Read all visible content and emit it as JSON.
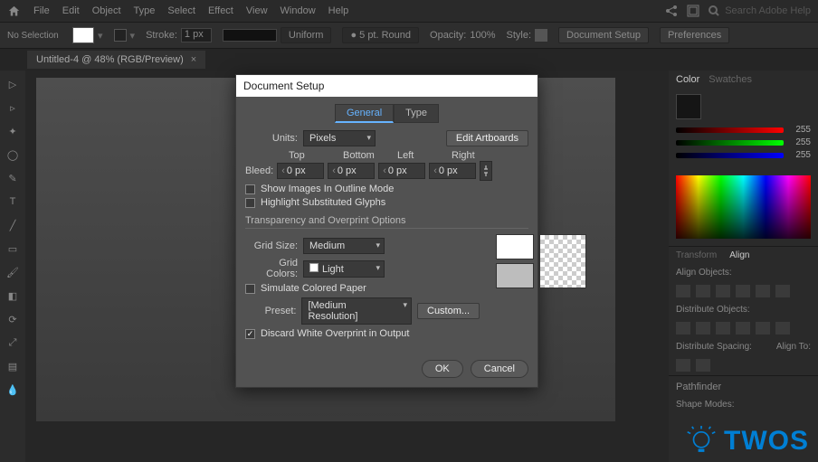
{
  "menu": {
    "items": [
      "File",
      "Edit",
      "Object",
      "Type",
      "Select",
      "Effect",
      "View",
      "Window",
      "Help"
    ],
    "search_placeholder": "Search Adobe Help"
  },
  "opts": {
    "no_selection": "No Selection",
    "stroke_label": "Stroke:",
    "stroke_value": "1 px",
    "uniform": "Uniform",
    "brush": "5 pt. Round",
    "opacity_label": "Opacity:",
    "opacity_value": "100%",
    "style_label": "Style:",
    "doc_setup": "Document Setup",
    "prefs": "Preferences"
  },
  "tab": {
    "title": "Untitled-4 @ 48% (RGB/Preview)",
    "close": "×"
  },
  "dlg": {
    "title": "Document Setup",
    "tab_general": "General",
    "tab_type": "Type",
    "units_label": "Units:",
    "units_value": "Pixels",
    "edit_artboards": "Edit Artboards",
    "bleed_label": "Bleed:",
    "top": "Top",
    "bottom": "Bottom",
    "left": "Left",
    "right": "Right",
    "bleed_top": "0 px",
    "bleed_bottom": "0 px",
    "bleed_left": "0 px",
    "bleed_right": "0 px",
    "show_images": "Show Images In Outline Mode",
    "highlight_glyphs": "Highlight Substituted Glyphs",
    "transp_section": "Transparency and Overprint Options",
    "grid_size_label": "Grid Size:",
    "grid_size_value": "Medium",
    "grid_colors_label": "Grid Colors:",
    "grid_colors_value": "Light",
    "simulate_paper": "Simulate Colored Paper",
    "preset_label": "Preset:",
    "preset_value": "[Medium Resolution]",
    "custom": "Custom...",
    "discard_white": "Discard White Overprint in Output",
    "ok": "OK",
    "cancel": "Cancel"
  },
  "right": {
    "tab_color": "Color",
    "tab_swatches": "Swatches",
    "slider_val": "255",
    "tab_transform": "Transform",
    "tab_align": "Align",
    "align_objects": "Align Objects:",
    "distribute_objects": "Distribute Objects:",
    "distribute_spacing": "Distribute Spacing:",
    "align_to": "Align To:",
    "pathfinder": "Pathfinder",
    "shape_modes": "Shape Modes:"
  },
  "twos": "TWOS"
}
